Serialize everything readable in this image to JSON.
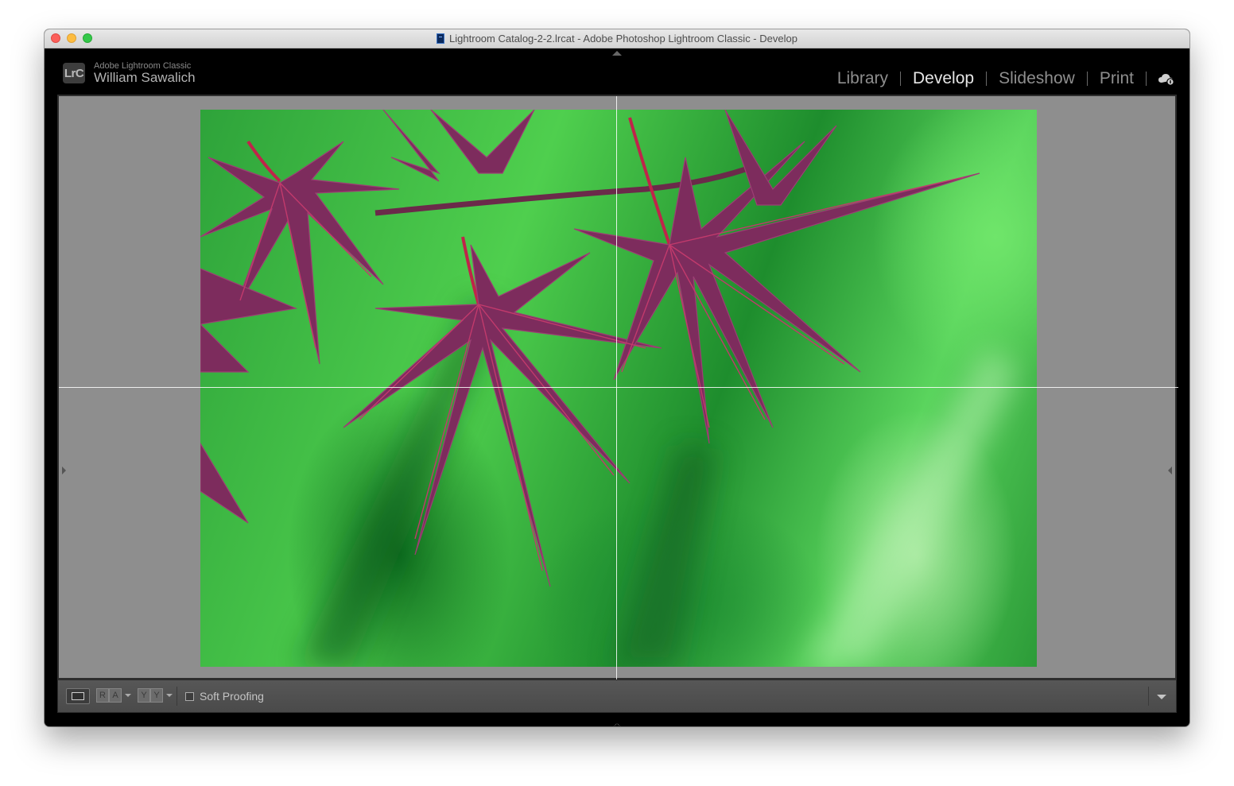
{
  "window": {
    "title": "Lightroom Catalog-2-2.lrcat - Adobe Photoshop Lightroom Classic - Develop"
  },
  "brand": {
    "badge": "LrC",
    "product": "Adobe Lightroom Classic",
    "user": "William Sawalich"
  },
  "modules": [
    {
      "label": "Library",
      "active": false
    },
    {
      "label": "Develop",
      "active": true
    },
    {
      "label": "Slideshow",
      "active": false
    },
    {
      "label": "Print",
      "active": false
    }
  ],
  "toolbar": {
    "ra_left": "R",
    "ra_right": "A",
    "yy_left": "Y",
    "yy_right": "Y",
    "soft_proofing_label": "Soft Proofing",
    "soft_proofing_checked": false
  },
  "icons": {
    "cloud": "cloud-sync-icon",
    "menu": "chevron-down-icon"
  },
  "colors": {
    "leaf": "#7a2b5a",
    "background_green": "#3fbf48",
    "active_module": "#e6e6e6",
    "inactive_module": "#8e8e8e"
  }
}
